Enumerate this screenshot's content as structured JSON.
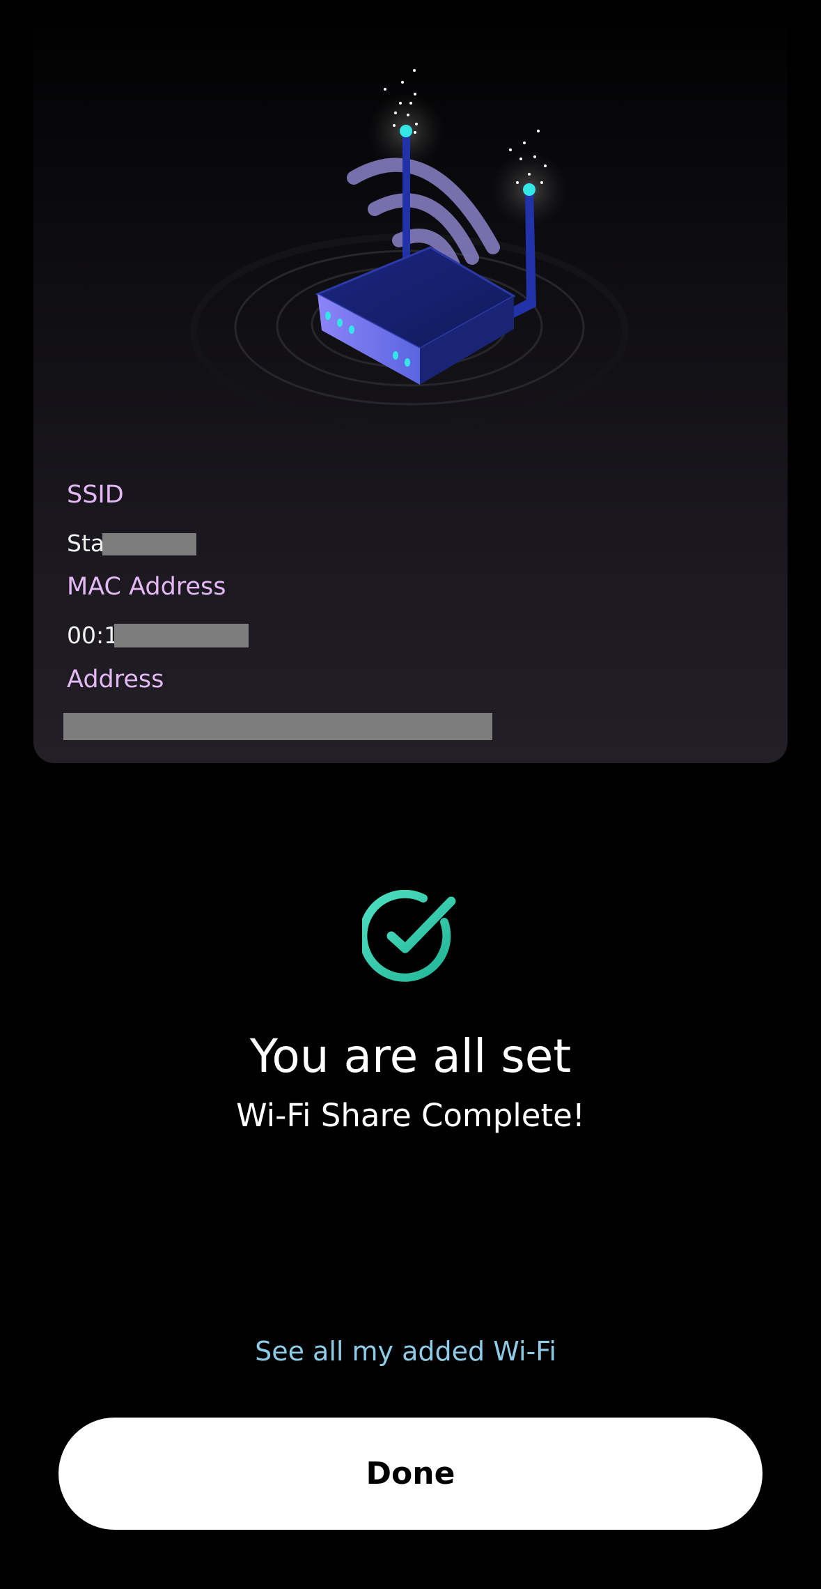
{
  "info_card": {
    "ssid_label": "SSID",
    "ssid_value_visible": "Sta",
    "mac_label": "MAC Address",
    "mac_value_visible": "00:1",
    "address_label": "Address"
  },
  "result": {
    "icon": "check-circle-icon",
    "title": "You are all set",
    "subtitle": "Wi-Fi Share Complete!"
  },
  "actions": {
    "see_all_link": "See all my added Wi-Fi",
    "done_label": "Done"
  },
  "colors": {
    "background": "#000000",
    "field_label": "#e3b8f5",
    "link": "#8ecbe6",
    "check": "#3ad6b5",
    "router_body": "#1f2c8f",
    "antenna_light": "#35e6e6"
  }
}
